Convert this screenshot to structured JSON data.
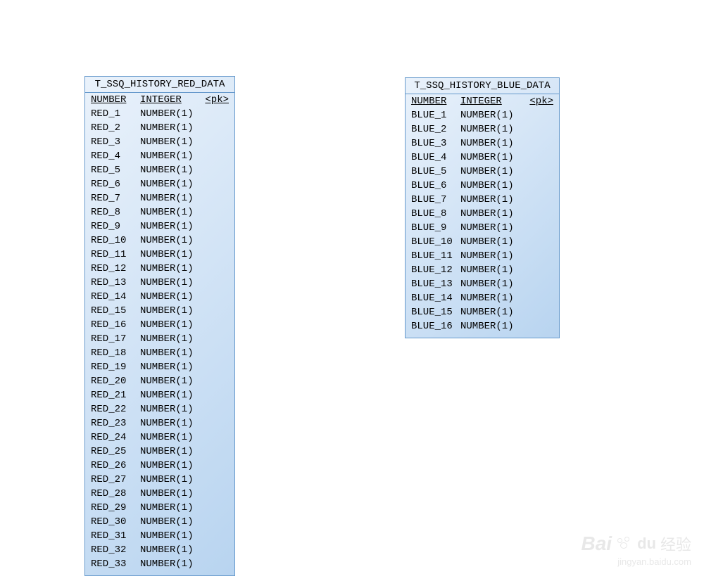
{
  "tables": {
    "red": {
      "title": "T_SSQ_HISTORY_RED_DATA",
      "header": {
        "col1": "NUMBER",
        "col2": "INTEGER",
        "col3": "<pk>"
      },
      "rows": [
        {
          "name": "RED_1",
          "type": "NUMBER(1)"
        },
        {
          "name": "RED_2",
          "type": "NUMBER(1)"
        },
        {
          "name": "RED_3",
          "type": "NUMBER(1)"
        },
        {
          "name": "RED_4",
          "type": "NUMBER(1)"
        },
        {
          "name": "RED_5",
          "type": "NUMBER(1)"
        },
        {
          "name": "RED_6",
          "type": "NUMBER(1)"
        },
        {
          "name": "RED_7",
          "type": "NUMBER(1)"
        },
        {
          "name": "RED_8",
          "type": "NUMBER(1)"
        },
        {
          "name": "RED_9",
          "type": "NUMBER(1)"
        },
        {
          "name": "RED_10",
          "type": "NUMBER(1)"
        },
        {
          "name": "RED_11",
          "type": "NUMBER(1)"
        },
        {
          "name": "RED_12",
          "type": "NUMBER(1)"
        },
        {
          "name": "RED_13",
          "type": "NUMBER(1)"
        },
        {
          "name": "RED_14",
          "type": "NUMBER(1)"
        },
        {
          "name": "RED_15",
          "type": "NUMBER(1)"
        },
        {
          "name": "RED_16",
          "type": "NUMBER(1)"
        },
        {
          "name": "RED_17",
          "type": "NUMBER(1)"
        },
        {
          "name": "RED_18",
          "type": "NUMBER(1)"
        },
        {
          "name": "RED_19",
          "type": "NUMBER(1)"
        },
        {
          "name": "RED_20",
          "type": "NUMBER(1)"
        },
        {
          "name": "RED_21",
          "type": "NUMBER(1)"
        },
        {
          "name": "RED_22",
          "type": "NUMBER(1)"
        },
        {
          "name": "RED_23",
          "type": "NUMBER(1)"
        },
        {
          "name": "RED_24",
          "type": "NUMBER(1)"
        },
        {
          "name": "RED_25",
          "type": "NUMBER(1)"
        },
        {
          "name": "RED_26",
          "type": "NUMBER(1)"
        },
        {
          "name": "RED_27",
          "type": "NUMBER(1)"
        },
        {
          "name": "RED_28",
          "type": "NUMBER(1)"
        },
        {
          "name": "RED_29",
          "type": "NUMBER(1)"
        },
        {
          "name": "RED_30",
          "type": "NUMBER(1)"
        },
        {
          "name": "RED_31",
          "type": "NUMBER(1)"
        },
        {
          "name": "RED_32",
          "type": "NUMBER(1)"
        },
        {
          "name": "RED_33",
          "type": "NUMBER(1)"
        }
      ]
    },
    "blue": {
      "title": "T_SSQ_HISTORY_BLUE_DATA",
      "header": {
        "col1": "NUMBER",
        "col2": "INTEGER",
        "col3": "<pk>"
      },
      "rows": [
        {
          "name": "BLUE_1",
          "type": "NUMBER(1)"
        },
        {
          "name": "BLUE_2",
          "type": "NUMBER(1)"
        },
        {
          "name": "BLUE_3",
          "type": "NUMBER(1)"
        },
        {
          "name": "BLUE_4",
          "type": "NUMBER(1)"
        },
        {
          "name": "BLUE_5",
          "type": "NUMBER(1)"
        },
        {
          "name": "BLUE_6",
          "type": "NUMBER(1)"
        },
        {
          "name": "BLUE_7",
          "type": "NUMBER(1)"
        },
        {
          "name": "BLUE_8",
          "type": "NUMBER(1)"
        },
        {
          "name": "BLUE_9",
          "type": "NUMBER(1)"
        },
        {
          "name": "BLUE_10",
          "type": "NUMBER(1)"
        },
        {
          "name": "BLUE_11",
          "type": "NUMBER(1)"
        },
        {
          "name": "BLUE_12",
          "type": "NUMBER(1)"
        },
        {
          "name": "BLUE_13",
          "type": "NUMBER(1)"
        },
        {
          "name": "BLUE_14",
          "type": "NUMBER(1)"
        },
        {
          "name": "BLUE_15",
          "type": "NUMBER(1)"
        },
        {
          "name": "BLUE_16",
          "type": "NUMBER(1)"
        }
      ]
    }
  },
  "watermark": {
    "bai": "Bai",
    "du": "du",
    "jingyan": "经验",
    "url": "jingyan.baidu.com"
  }
}
